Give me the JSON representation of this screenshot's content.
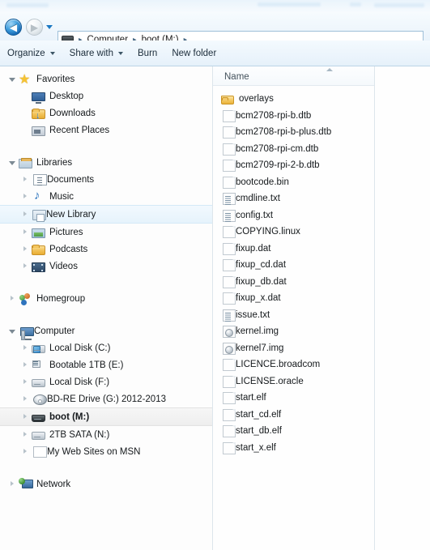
{
  "window": {
    "colors": {
      "accent_back_button": "#1565b0",
      "selection_hover": "#e6f3fc",
      "selection_grey": "#eeeeee",
      "folder_yellow": "#eab23a",
      "divider": "#dde6ec"
    }
  },
  "navigation": {
    "back_label": "◀",
    "forward_label": "▶",
    "back_name": "Back",
    "forward_name": "Forward",
    "recent_pages_label": "Recent pages",
    "breadcrumb": [
      {
        "label": "Computer"
      },
      {
        "label": "boot (M:)"
      }
    ],
    "separator": "▸"
  },
  "toolbar": {
    "items": [
      {
        "label": "Organize",
        "has_caret": true
      },
      {
        "label": "Share with",
        "has_caret": true
      },
      {
        "label": "Burn",
        "has_caret": false
      },
      {
        "label": "New folder",
        "has_caret": false
      }
    ]
  },
  "sidebar": {
    "groups": [
      {
        "header": {
          "label": "Favorites",
          "icon": "star-icon",
          "expanded": true
        },
        "items": [
          {
            "label": "Desktop",
            "icon": "desktop-icon",
            "twisty": "none"
          },
          {
            "label": "Downloads",
            "icon": "downloads-folder-icon",
            "twisty": "none"
          },
          {
            "label": "Recent Places",
            "icon": "recent-places-icon",
            "twisty": "none"
          }
        ]
      },
      {
        "header": {
          "label": "Libraries",
          "icon": "libraries-icon",
          "expanded": true
        },
        "items": [
          {
            "label": "Documents",
            "icon": "documents-icon",
            "twisty": "closed"
          },
          {
            "label": "Music",
            "icon": "music-icon",
            "twisty": "closed"
          },
          {
            "label": "New Library",
            "icon": "new-library-icon",
            "twisty": "closed",
            "state": "hover"
          },
          {
            "label": "Pictures",
            "icon": "pictures-icon",
            "twisty": "closed"
          },
          {
            "label": "Podcasts",
            "icon": "podcasts-folder-icon",
            "twisty": "closed"
          },
          {
            "label": "Videos",
            "icon": "videos-icon",
            "twisty": "closed"
          }
        ]
      },
      {
        "header": {
          "label": "Homegroup",
          "icon": "homegroup-icon",
          "expanded": false
        },
        "items": []
      },
      {
        "header": {
          "label": "Computer",
          "icon": "computer-icon",
          "expanded": true
        },
        "items": [
          {
            "label": "Local Disk (C:)",
            "icon": "system-drive-icon",
            "twisty": "closed"
          },
          {
            "label": "Bootable 1TB (E:)",
            "icon": "network-drive-icon",
            "twisty": "closed"
          },
          {
            "label": "Local Disk (F:)",
            "icon": "drive-icon",
            "twisty": "closed"
          },
          {
            "label": "BD-RE Drive (G:) 2012-2013",
            "icon": "optical-disc-icon",
            "twisty": "closed"
          },
          {
            "label": "boot (M:)",
            "icon": "removable-drive-icon",
            "twisty": "closed",
            "state": "selected"
          },
          {
            "label": "2TB SATA (N:)",
            "icon": "drive-icon",
            "twisty": "closed"
          },
          {
            "label": "My Web Sites on MSN",
            "icon": "page-icon",
            "twisty": "closed"
          }
        ]
      },
      {
        "header": {
          "label": "Network",
          "icon": "network-icon",
          "expanded": false
        },
        "items": []
      }
    ]
  },
  "file_list": {
    "column_header": "Name",
    "sort_direction": "ascending",
    "items": [
      {
        "name": "overlays",
        "icon": "folder-icon",
        "kind": "folder"
      },
      {
        "name": "bcm2708-rpi-b.dtb",
        "icon": "file-icon",
        "kind": "file"
      },
      {
        "name": "bcm2708-rpi-b-plus.dtb",
        "icon": "file-icon",
        "kind": "file"
      },
      {
        "name": "bcm2708-rpi-cm.dtb",
        "icon": "file-icon",
        "kind": "file"
      },
      {
        "name": "bcm2709-rpi-2-b.dtb",
        "icon": "file-icon",
        "kind": "file"
      },
      {
        "name": "bootcode.bin",
        "icon": "file-icon",
        "kind": "file"
      },
      {
        "name": "cmdline.txt",
        "icon": "text-file-icon",
        "kind": "text"
      },
      {
        "name": "config.txt",
        "icon": "text-file-icon",
        "kind": "text"
      },
      {
        "name": "COPYING.linux",
        "icon": "file-icon",
        "kind": "file"
      },
      {
        "name": "fixup.dat",
        "icon": "file-icon",
        "kind": "file"
      },
      {
        "name": "fixup_cd.dat",
        "icon": "file-icon",
        "kind": "file"
      },
      {
        "name": "fixup_db.dat",
        "icon": "file-icon",
        "kind": "file"
      },
      {
        "name": "fixup_x.dat",
        "icon": "file-icon",
        "kind": "file"
      },
      {
        "name": "issue.txt",
        "icon": "text-file-icon",
        "kind": "text"
      },
      {
        "name": "kernel.img",
        "icon": "disc-image-icon",
        "kind": "image"
      },
      {
        "name": "kernel7.img",
        "icon": "disc-image-icon",
        "kind": "image"
      },
      {
        "name": "LICENCE.broadcom",
        "icon": "file-icon",
        "kind": "file"
      },
      {
        "name": "LICENSE.oracle",
        "icon": "file-icon",
        "kind": "file"
      },
      {
        "name": "start.elf",
        "icon": "file-icon",
        "kind": "file"
      },
      {
        "name": "start_cd.elf",
        "icon": "file-icon",
        "kind": "file"
      },
      {
        "name": "start_db.elf",
        "icon": "file-icon",
        "kind": "file"
      },
      {
        "name": "start_x.elf",
        "icon": "file-icon",
        "kind": "file"
      }
    ]
  }
}
